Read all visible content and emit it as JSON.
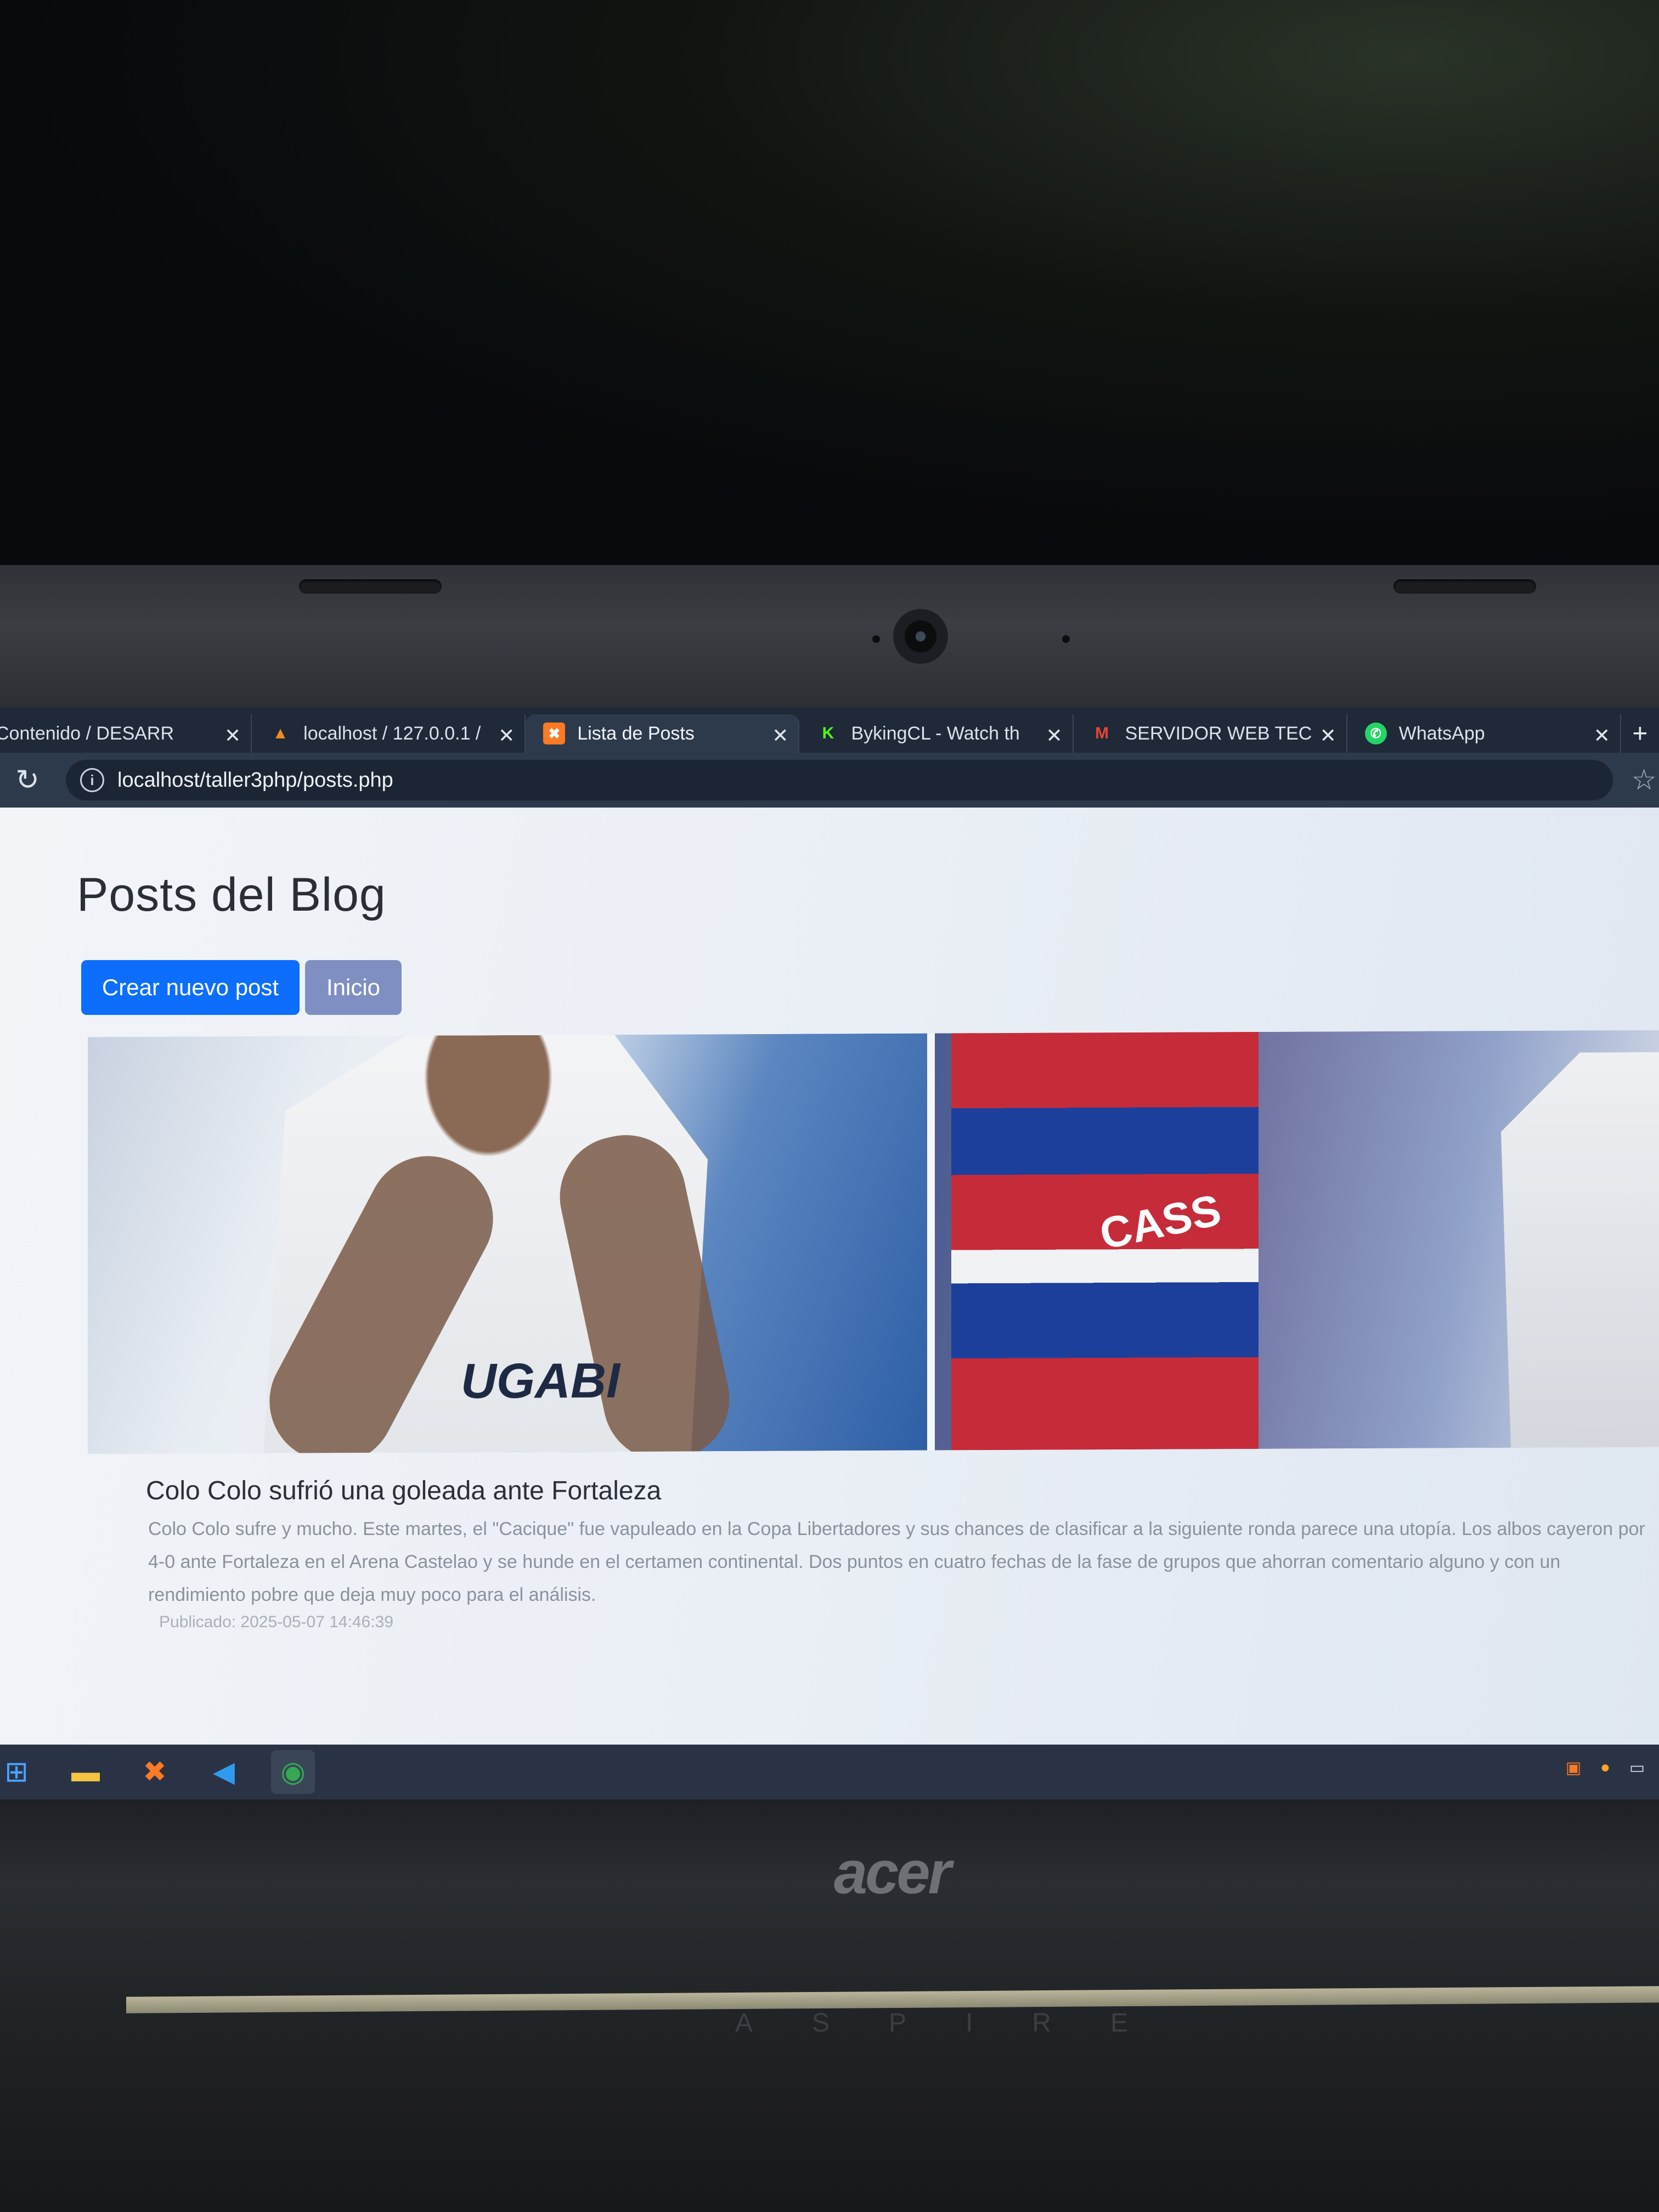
{
  "browser": {
    "tabs": [
      {
        "label": "Contenido / DESARR",
        "icon": "document-icon"
      },
      {
        "label": "localhost / 127.0.0.1 /",
        "icon": "phpmyadmin-icon"
      },
      {
        "label": "Lista de Posts",
        "icon": "xampp-icon",
        "active": true
      },
      {
        "label": "BykingCL - Watch th",
        "icon": "kick-icon"
      },
      {
        "label": "SERVIDOR WEB TEC",
        "icon": "gmail-icon"
      },
      {
        "label": "WhatsApp",
        "icon": "whatsapp-icon"
      }
    ],
    "address": "localhost/taller3php/posts.php"
  },
  "page": {
    "title": "Posts del Blog",
    "buttons": {
      "create": "Crear nuevo post",
      "home": "Inicio"
    },
    "post": {
      "title": "Colo Colo sufrió una goleada ante Fortaleza",
      "body": "Colo Colo sufre y mucho. Este martes, el \"Cacique\" fue vapuleado en la Copa Libertadores y sus chances de clasificar a la siguiente ronda parece una utopía. Los albos cayeron por 4-0 ante Fortaleza en el Arena Castelao y se hunde en el certamen continental. Dos puntos en cuatro fechas de la fase de grupos que ahorran comentario alguno y con un rendimiento pobre que deja muy poco para el análisis.",
      "date": "Publicado: 2025-05-07 14:46:39",
      "image_text_left": "UGABI",
      "image_text_right": "CASS"
    }
  },
  "laptop": {
    "brand": "acer",
    "model": "ASPIRE"
  },
  "taskbar": {
    "icons": [
      "windows-start-icon",
      "file-explorer-icon",
      "xampp-icon",
      "vscode-icon",
      "chrome-icon"
    ]
  }
}
